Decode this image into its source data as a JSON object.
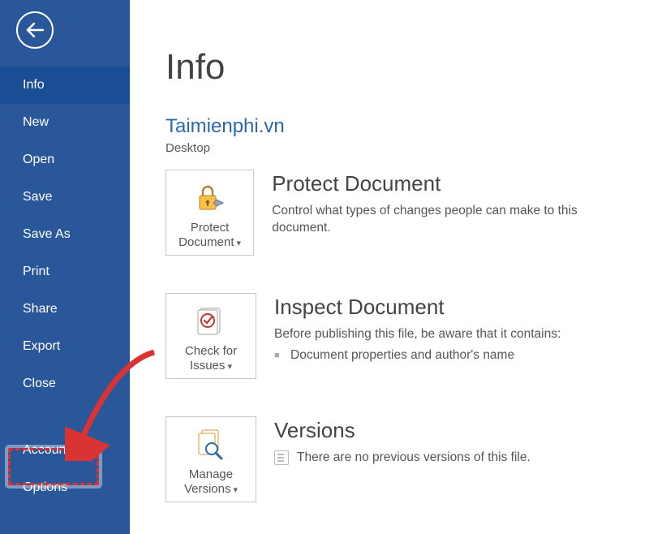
{
  "sidebar": {
    "items": [
      {
        "label": "Info"
      },
      {
        "label": "New"
      },
      {
        "label": "Open"
      },
      {
        "label": "Save"
      },
      {
        "label": "Save As"
      },
      {
        "label": "Print"
      },
      {
        "label": "Share"
      },
      {
        "label": "Export"
      },
      {
        "label": "Close"
      },
      {
        "label": "Account"
      },
      {
        "label": "Options"
      }
    ]
  },
  "page": {
    "title": "Info",
    "doc_title": "Taimienphi.vn",
    "doc_location": "Desktop"
  },
  "sections": {
    "protect": {
      "tile_label_1": "Protect",
      "tile_label_2": "Document",
      "head": "Protect Document",
      "desc": "Control what types of changes people can make to this document."
    },
    "inspect": {
      "tile_label_1": "Check for",
      "tile_label_2": "Issues",
      "head": "Inspect Document",
      "desc": "Before publishing this file, be aware that it contains:",
      "bullet_1": "Document properties and author's name"
    },
    "versions": {
      "tile_label_1": "Manage",
      "tile_label_2": "Versions",
      "head": "Versions",
      "desc": "There are no previous versions of this file."
    }
  }
}
